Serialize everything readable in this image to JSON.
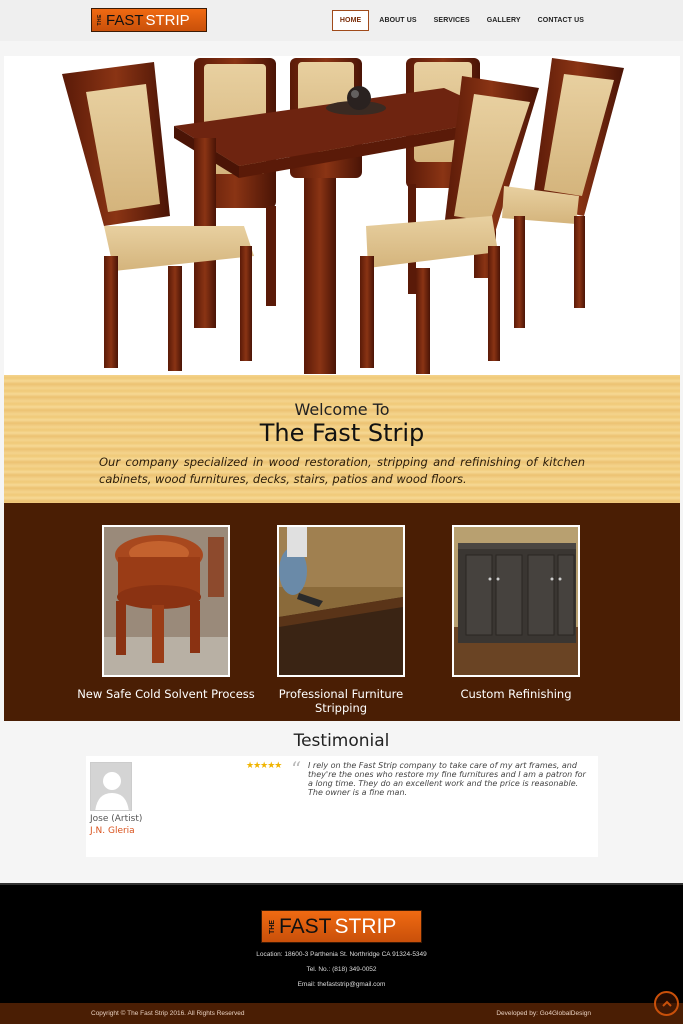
{
  "header": {
    "logo": {
      "the": "THE",
      "fast": "FAST",
      "strip": "STRIP"
    },
    "nav": [
      {
        "label": "HOME",
        "active": true
      },
      {
        "label": "ABOUT US",
        "active": false
      },
      {
        "label": "SERVICES",
        "active": false
      },
      {
        "label": "GALLERY",
        "active": false
      },
      {
        "label": "CONTACT US",
        "active": false
      }
    ]
  },
  "welcome": {
    "subtitle": "Welcome To",
    "title": "The Fast Strip",
    "description": "Our company specialized in wood restoration, stripping and refinishing of kitchen cabinets, wood furnitures, decks, stairs, patios and wood floors."
  },
  "services": [
    {
      "label": "New Safe Cold Solvent Process"
    },
    {
      "label": "Professional Furniture Stripping"
    },
    {
      "label": "Custom Refinishing"
    }
  ],
  "testimonial": {
    "title": "Testimonial",
    "rating": 5,
    "stars": "★★★★★",
    "quote_mark": "“",
    "text": "I rely on the Fast Strip company to take care of my art frames, and they're the ones who restore my fine furnitures and I am a patron for a long time. They do an excellent work and the price is reasonable. The owner is a fine man.",
    "name": "Jose (Artist)",
    "org": "J.N. Gleria"
  },
  "footer": {
    "logo": {
      "the": "THE",
      "fast": "FAST",
      "strip": "STRIP"
    },
    "location": "Location: 18600-3 Parthenia St. Northridge CA 91324-5349",
    "phone": "Tel. No.: (818) 349-0052",
    "email": "Email: thefaststrip@gmail.com",
    "copyright": "Copyright © The Fast Strip 2016. All Rights Reserved",
    "developer": "Developed by: Go4GlobalDesign"
  },
  "colors": {
    "brand_orange": "#f06a12",
    "brown": "#4a1e04",
    "wood_light": "#f4d38c",
    "active_nav_border": "#a04a1a",
    "org_link": "#d9531e"
  }
}
